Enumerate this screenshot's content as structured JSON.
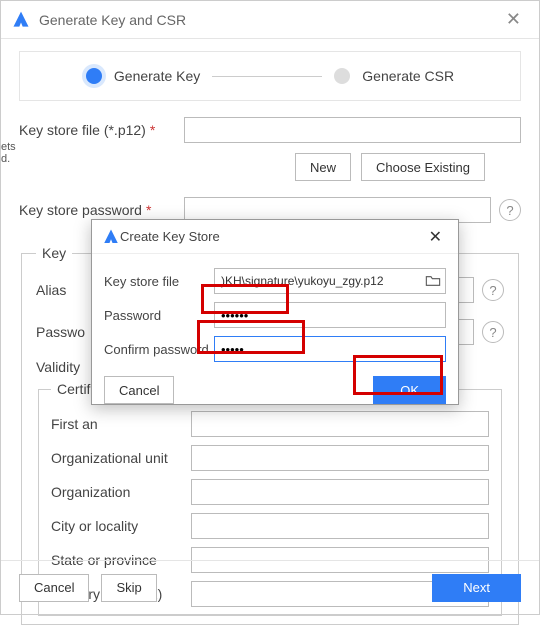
{
  "window": {
    "title": "Generate Key and CSR"
  },
  "steps": {
    "left": "Generate Key",
    "right": "Generate CSR"
  },
  "form": {
    "keystore_file_label": "Key store file (*.p12)",
    "keystore_file_value": "",
    "new_btn": "New",
    "choose_existing_btn": "Choose Existing",
    "keystore_pwd_label": "Key store password",
    "keystore_pwd_value": ""
  },
  "key_group": {
    "legend": "Key",
    "alias_label": "Alias",
    "alias_value": "",
    "password_label": "Passwo",
    "validity_label": "Validity",
    "cert_legend": "Certifi",
    "first_label": "First an",
    "ou_label": "Organizational unit",
    "org_label": "Organization",
    "city_label": "City or locality",
    "state_label": "State or province",
    "country_label": "Country code(XX)"
  },
  "footer": {
    "cancel": "Cancel",
    "skip": "Skip",
    "next": "Next"
  },
  "dialog": {
    "title": "Create Key Store",
    "file_label": "Key store file",
    "file_value": ")KH\\signature\\yukoyu_zgy.p12",
    "pwd_label": "Password",
    "pwd_value": "••••••",
    "confirm_label": "Confirm password",
    "confirm_value": "•••••",
    "cancel": "Cancel",
    "ok": "OK"
  },
  "edge_text": "ets\nd."
}
